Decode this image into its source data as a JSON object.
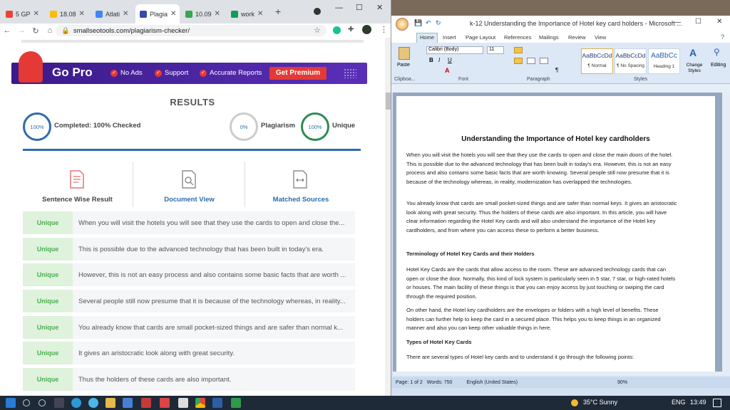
{
  "browser": {
    "tabs": [
      {
        "label": "5 GP",
        "color": "#ea4335"
      },
      {
        "label": "18.08",
        "color": "#fbbc05"
      },
      {
        "label": "Atlati",
        "color": "#4285f4"
      },
      {
        "label": "Plagia",
        "color": "#3949ab"
      },
      {
        "label": "10.09",
        "color": "#34a853"
      },
      {
        "label": "work",
        "color": "#0f9d58"
      }
    ],
    "url": "smallseotools.com/plagiarism-checker/"
  },
  "promo": {
    "title": "Go Pro",
    "items": [
      "No Ads",
      "Support",
      "Accurate Reports"
    ],
    "button": "Get Premium"
  },
  "results": {
    "heading": "RESULTS",
    "completed_pct": "100%",
    "completed_label": "Completed: 100% Checked",
    "plag_pct": "0%",
    "plag_label": "Plagiarism",
    "unique_pct": "100%",
    "unique_label": "Unique",
    "tabs": [
      "Sentence Wise Result",
      "Document View",
      "Matched Sources"
    ],
    "rows": [
      {
        "badge": "Unique",
        "text": "When you will visit the hotels you will see that they use the cards to open and close the..."
      },
      {
        "badge": "Unique",
        "text": "This is possible due to the advanced technology that has been built in today's era."
      },
      {
        "badge": "Unique",
        "text": "However, this is not an easy process and also contains some basic facts that are worth ..."
      },
      {
        "badge": "Unique",
        "text": "Several people still now presume that it is because of the technology whereas, in reality..."
      },
      {
        "badge": "Unique",
        "text": "You already know that cards are small pocket-sized things and are safer than normal k..."
      },
      {
        "badge": "Unique",
        "text": "It gives an aristocratic look along with great security."
      },
      {
        "badge": "Unique",
        "text": "Thus the holders of these cards are also important."
      }
    ]
  },
  "word": {
    "title": "k-12 Understanding the Importance of Hotel key card holders - Microsoft ...",
    "ribbon_tabs": [
      "Home",
      "Insert",
      "Page Layout",
      "References",
      "Mailings",
      "Review",
      "View"
    ],
    "font_name": "Calibri (Body)",
    "font_size": "11",
    "groups": [
      "Clipboa...",
      "Font",
      "Paragraph",
      "Styles",
      "Editing"
    ],
    "paste_label": "Paste",
    "styles": [
      {
        "preview": "AaBbCcDd",
        "name": "¶ Normal"
      },
      {
        "preview": "AaBbCcDd",
        "name": "¶ No Spacing"
      },
      {
        "preview": "AaBbCc",
        "name": "Heading 1"
      }
    ],
    "change_styles": "Change Styles",
    "editing": "Editing",
    "doc_heading": "Understanding the Importance of Hotel key cardholders",
    "paragraphs": [
      "When you will visit the hotels you will see that they use the cards to open and close the main doors of the hotel. This is possible due to the advanced technology that has been built in today's era. However, this is not an easy process and also contains some basic facts that are worth knowing. Several people still now presume that it is because of the technology whereas, in reality, modernization has overlapped the technologies.",
      "You already know that cards are small pocket-sized things and are safer than normal keys. It gives an aristocratic look along with great security. Thus the holders of these cards are also important. In this article, you will have clear information regarding the Hotel Key cards and will also understand the importance of the Hotel key cardholders, and from where you can access these to perform a better business.",
      "Terminology of Hotel Key Cards and their Holders",
      "Hotel Key Cards are the cards that allow access to the room. These are advanced technology cards that can open or close the door. Normally, this kind of lock system is particularly seen in 5 star, 7 star, or high-rated hotels or houses. The main facility of these things is that you can enjoy access by just touching or swiping the card through the required position.",
      "On other hand, the Hotel key cardholders are the envelopes or folders with a high level of benefits. These holders can further help to keep the card in a secured place. This helps you to keep things in an organized manner and also you can keep other valuable things in here.",
      "Types of Hotel Key Cards",
      "There are several types of Hotel key cards and to understand it go through the following points:"
    ],
    "status": {
      "page": "Page: 1 of 2",
      "words": "Words: 750",
      "lang": "English (United States)",
      "zoom": "90%"
    }
  },
  "taskbar": {
    "weather": "35°C  Sunny",
    "lang": "ENG",
    "time": "13:49"
  }
}
